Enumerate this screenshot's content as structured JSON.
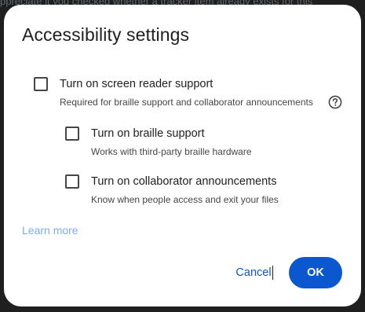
{
  "backdrop": {
    "line1": "ppreciate it you checked whether a tracker item already exists for this"
  },
  "dialog": {
    "title": "Accessibility settings",
    "options": [
      {
        "label": "Turn on screen reader support",
        "description": "Required for braille support and collaborator announcements",
        "checked": false,
        "help_icon": "help-circle-icon"
      },
      {
        "label": "Turn on braille support",
        "description": "Works with third-party braille hardware",
        "checked": false
      },
      {
        "label": "Turn on collaborator announcements",
        "description": "Know when people access and exit your files",
        "checked": false
      }
    ],
    "learn_more": "Learn more",
    "cancel_label": "Cancel",
    "ok_label": "OK"
  },
  "colors": {
    "accent": "#0b57d0",
    "link": "#7cacf8",
    "backdrop": "#1f1f1f"
  }
}
